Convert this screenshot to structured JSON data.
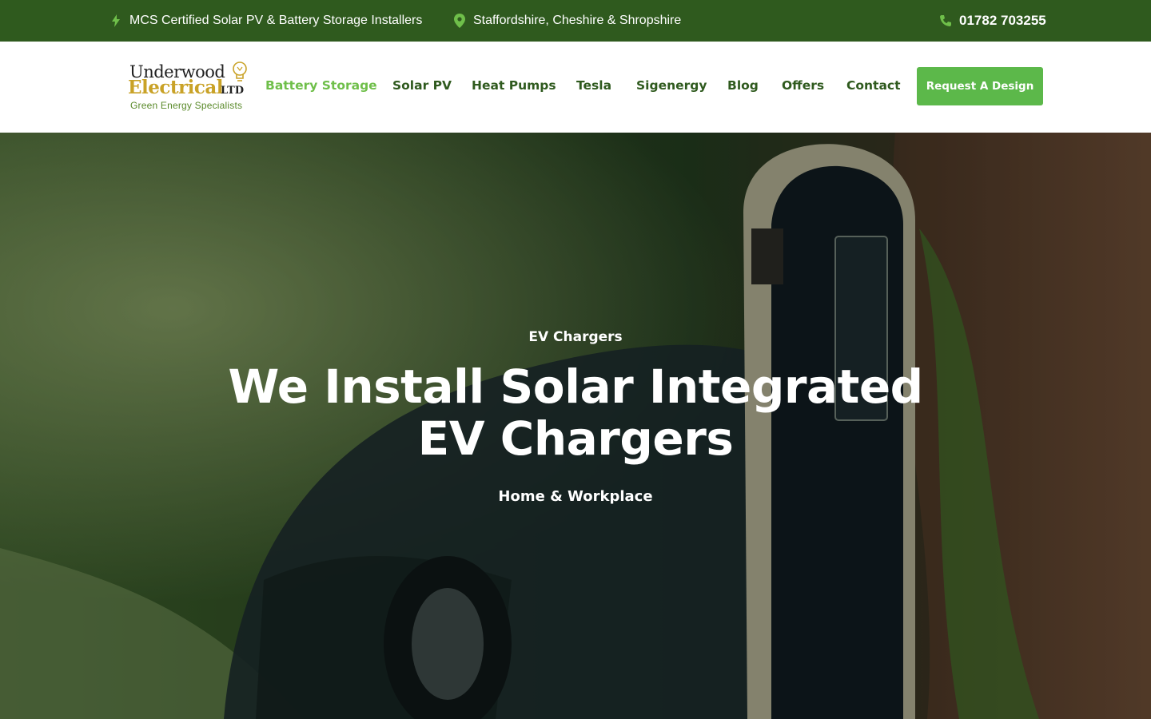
{
  "topbar": {
    "certification": "MCS Certified Solar PV & Battery Storage Installers",
    "location": "Staffordshire, Cheshire & Shropshire",
    "phone": "01782 703255",
    "icons": {
      "certification": "lightning-icon",
      "location": "map-pin-icon",
      "phone": "phone-icon"
    },
    "accent": "#6fbf4a",
    "background": "#2f5a1e"
  },
  "logo": {
    "line1": "Underwood",
    "line2": "Electrical",
    "suffix": "LTD",
    "tagline": "Green Energy Specialists"
  },
  "nav": {
    "items": [
      {
        "label": "Battery Storage",
        "active": true
      },
      {
        "label": "Solar PV",
        "active": false
      },
      {
        "label": "Heat Pumps",
        "active": false
      },
      {
        "label": "Tesla",
        "active": false
      },
      {
        "label": "Sigenergy",
        "active": false
      },
      {
        "label": "Blog",
        "active": false
      },
      {
        "label": "Offers",
        "active": false
      },
      {
        "label": "Contact",
        "active": false
      }
    ],
    "cta_label": "Request A Design",
    "cta_color": "#5cb84a"
  },
  "hero": {
    "eyebrow": "EV Chargers",
    "title_line1": "We Install Solar Integrated",
    "title_line2": "EV Chargers",
    "subtitle": "Home & Workplace"
  }
}
